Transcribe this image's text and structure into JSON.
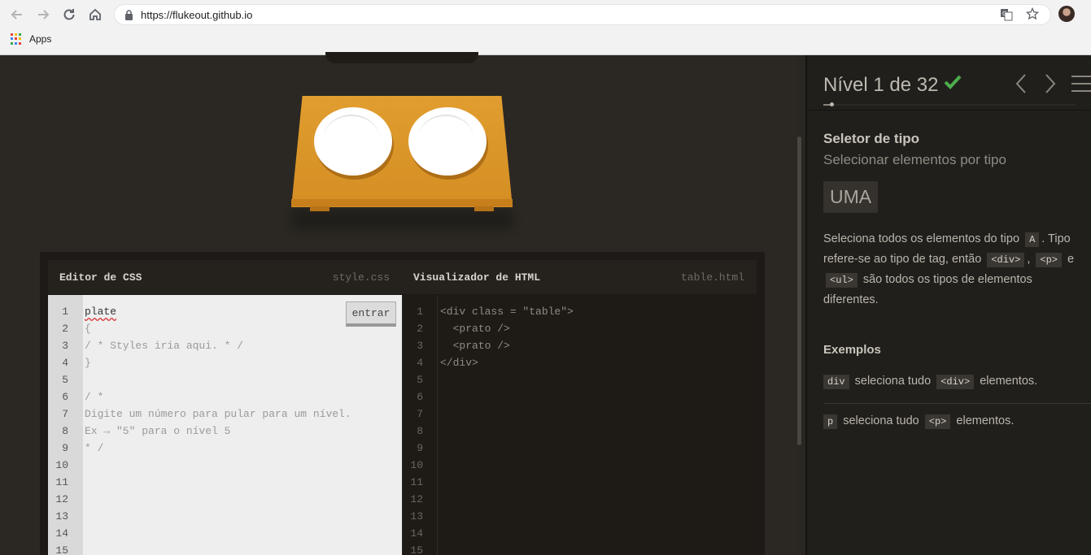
{
  "browser": {
    "url": "https://flukeout.github.io",
    "bookmarks": {
      "apps_label": "Apps"
    },
    "apps_colors": [
      "#ea4335",
      "#fbbc05",
      "#34a853",
      "#4285f4",
      "#ea4335",
      "#fbbc05",
      "#34a853",
      "#4285f4",
      "#ea4335"
    ]
  },
  "editor": {
    "css_title": "Editor de CSS",
    "css_file": "style.css",
    "html_title": "Visualizador de HTML",
    "html_file": "table.html",
    "enter_label": "entrar",
    "line_numbers": [
      "1",
      "2",
      "3",
      "4",
      "5",
      "6",
      "7",
      "8",
      "9",
      "10",
      "11",
      "12",
      "13",
      "14",
      "15"
    ],
    "css_lines": [
      "plate",
      "{",
      "/ * Styles iria aqui. * /",
      "}",
      "",
      "/ *",
      "Digite um número para pular para um nível.",
      "Ex → \"5\" para o nível 5",
      "* /"
    ],
    "html_lines": [
      "<div class = \"table\">",
      "  <prato />",
      "  <prato />",
      "</div>"
    ]
  },
  "sidebar": {
    "level_title": "Nível 1 de 32",
    "level_current": 1,
    "level_total": 32,
    "selector_name": "Seletor de tipo",
    "selector_subtitle": "Selecionar elementos por tipo",
    "syntax": "UMA",
    "description": {
      "p1": "Seleciona todos os elementos do tipo",
      "tag_a": "A",
      "p2": ". Tipo refere-se ao tipo de tag, então",
      "tag_div": "<div>",
      "p3": ",",
      "tag_p": "<p>",
      "p4": "e",
      "tag_ul": "<ul>",
      "p5": "são todos os tipos de elementos diferentes."
    },
    "examples_title": "Exemplos",
    "examples": [
      {
        "tag": "div",
        "text": "seleciona tudo",
        "element": "<div>",
        "suffix": "elementos."
      },
      {
        "tag": "p",
        "text": "seleciona tudo",
        "element": "<p>",
        "suffix": "elementos."
      }
    ]
  },
  "colors": {
    "accent_check": "#4cae4c",
    "table": "#e19d2f"
  }
}
